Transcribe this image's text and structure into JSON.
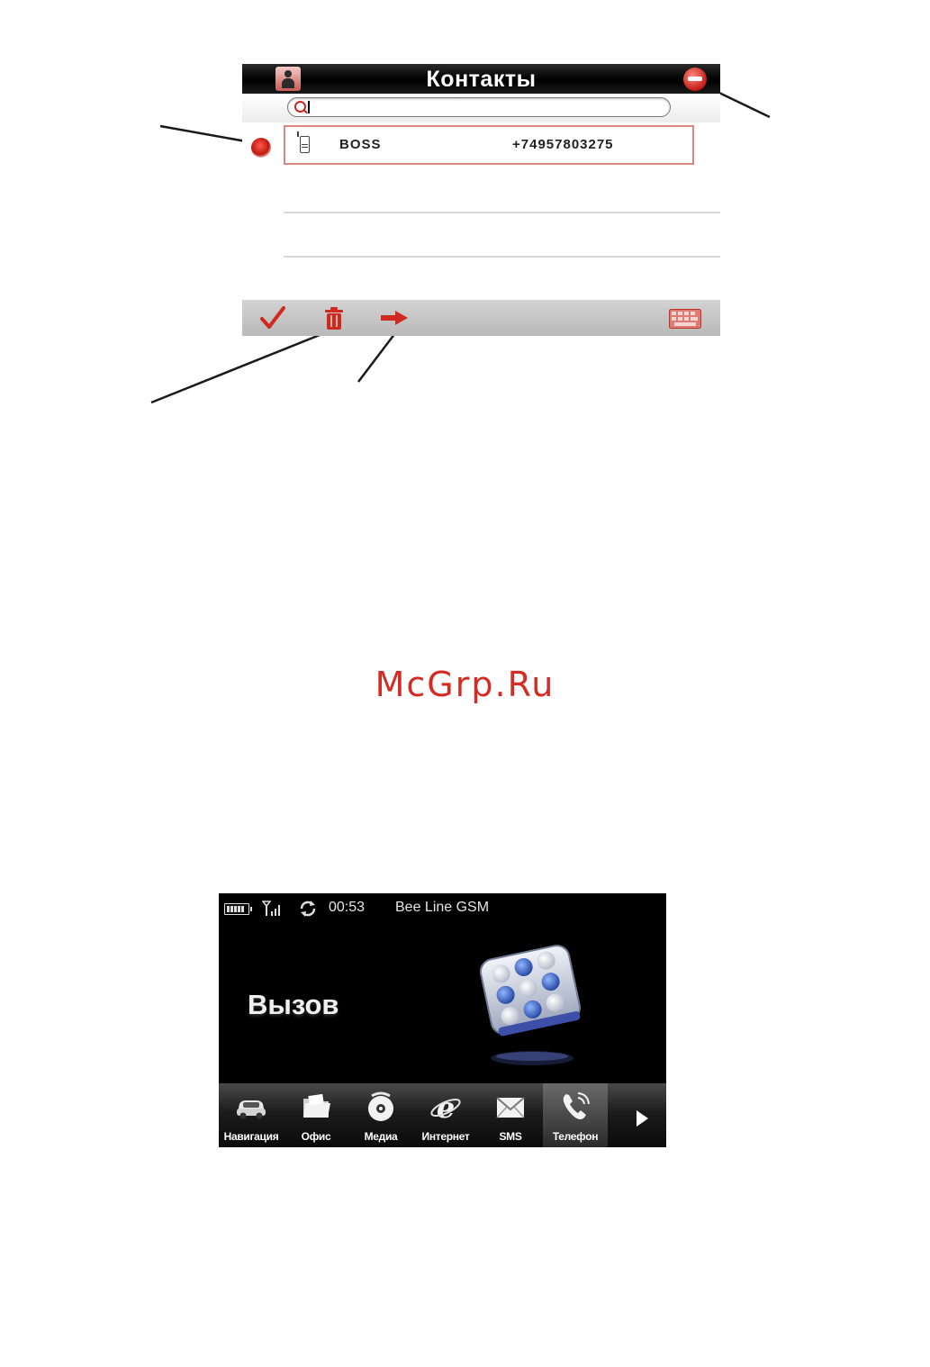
{
  "contacts_screen": {
    "title": "Контакты",
    "search": {
      "value": ""
    },
    "rows": [
      {
        "name": "BOSS",
        "number": "+74957803275",
        "selected": true
      }
    ],
    "accent_color": "#d02a20"
  },
  "watermark": "McGrp.Ru",
  "phone_screen": {
    "status": {
      "time": "00:53",
      "operator": "Bee Line GSM"
    },
    "title": "Вызов",
    "dock": [
      {
        "label": "Навигация",
        "icon": "car-icon"
      },
      {
        "label": "Офис",
        "icon": "folder-icon"
      },
      {
        "label": "Медиа",
        "icon": "media-disc-icon"
      },
      {
        "label": "Интернет",
        "icon": "internet-explorer-icon"
      },
      {
        "label": "SMS",
        "icon": "envelope-icon"
      },
      {
        "label": "Телефон",
        "icon": "phone-handset-icon",
        "active": true
      }
    ]
  }
}
